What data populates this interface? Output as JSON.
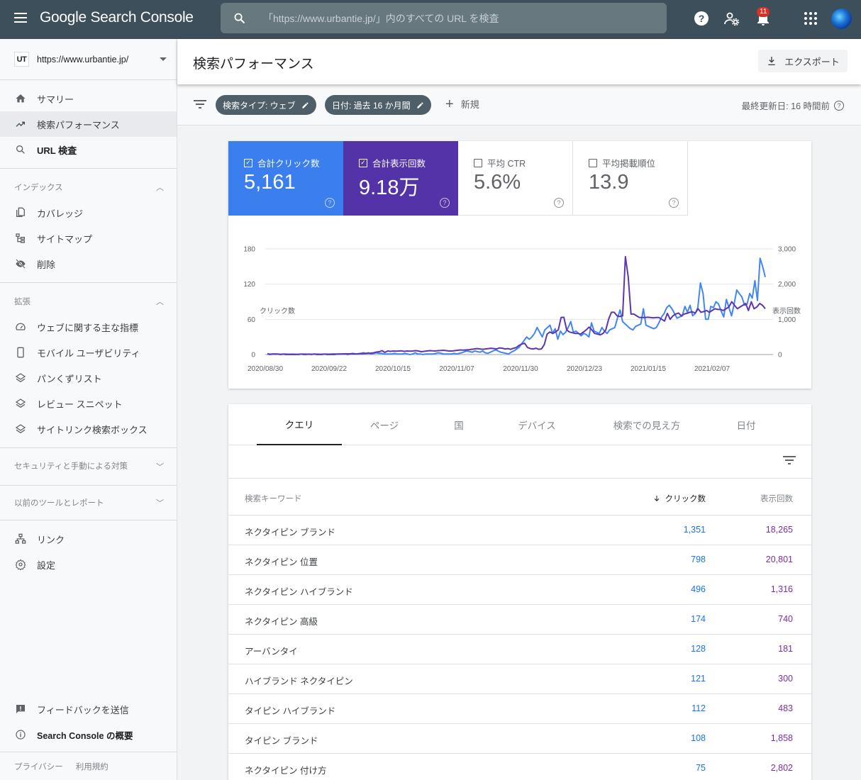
{
  "topbar": {
    "app_name_brand": "Google",
    "app_name_product": "Search Console",
    "search_placeholder": "「https://www.urbantie.jp/」内のすべての URL を検査",
    "notification_count": "11",
    "icons": [
      "menu-icon",
      "search-icon",
      "help-icon",
      "manage-users-icon",
      "notifications-icon",
      "apps-grid-icon",
      "avatar"
    ]
  },
  "sidebar": {
    "property": {
      "badge": "UT",
      "url": "https://www.urbantie.jp/"
    },
    "main_items": [
      {
        "label": "サマリー",
        "icon": "home-icon"
      },
      {
        "label": "検索パフォーマンス",
        "icon": "trending-up-icon",
        "active": true
      },
      {
        "label": "URL 検査",
        "icon": "search-icon"
      }
    ],
    "index_section": {
      "title": "インデックス",
      "items": [
        {
          "label": "カバレッジ",
          "icon": "coverage-icon"
        },
        {
          "label": "サイトマップ",
          "icon": "sitemap-icon"
        },
        {
          "label": "削除",
          "icon": "removal-icon"
        }
      ]
    },
    "enhancements_section": {
      "title": "拡張",
      "items": [
        {
          "label": "ウェブに関する主な指標",
          "icon": "speed-gauge-icon"
        },
        {
          "label": "モバイル ユーザビリティ",
          "icon": "mobile-icon"
        },
        {
          "label": "パンくずリスト",
          "icon": "layers-icon"
        },
        {
          "label": "レビュー スニペット",
          "icon": "layers-icon"
        },
        {
          "label": "サイトリンク検索ボックス",
          "icon": "layers-icon"
        }
      ]
    },
    "security_section": {
      "title": "セキュリティと手動による対策"
    },
    "legacy_section": {
      "title": "以前のツールとレポート"
    },
    "other_items": [
      {
        "label": "リンク",
        "icon": "links-icon"
      },
      {
        "label": "設定",
        "icon": "settings-icon"
      }
    ],
    "bottom_items": [
      {
        "label": "フィードバックを送信",
        "icon": "feedback-icon"
      },
      {
        "label": "Search Console の概要",
        "icon": "info-icon"
      }
    ],
    "footer": {
      "privacy": "プライバシー",
      "terms": "利用規約"
    }
  },
  "header": {
    "title": "検索パフォーマンス",
    "export_label": "エクスポート"
  },
  "filterbar": {
    "chips": [
      {
        "label": "検索タイプ: ウェブ"
      },
      {
        "label": "日付: 過去 16 か月間"
      }
    ],
    "new_label": "新規",
    "last_updated": "最終更新日: 16 時間前"
  },
  "metrics": [
    {
      "label": "合計クリック数",
      "value": "5,161",
      "checked": true,
      "color": "#3b7eee"
    },
    {
      "label": "合計表示回数",
      "value": "9.18万",
      "checked": true,
      "color": "#5433a8"
    },
    {
      "label": "平均 CTR",
      "value": "5.6%",
      "checked": false
    },
    {
      "label": "平均掲載順位",
      "value": "13.9",
      "checked": false
    }
  ],
  "chart_data": {
    "type": "line",
    "left_axis_label": "クリック数",
    "right_axis_label": "表示回数",
    "left_ticks": [
      "180",
      "120",
      "60",
      "0"
    ],
    "right_ticks": [
      "3,000",
      "2,000",
      "1,000",
      "0"
    ],
    "left_ylim": [
      0,
      180
    ],
    "right_ylim": [
      0,
      3000
    ],
    "x_tick_labels": [
      "2020/08/30",
      "2020/09/22",
      "2020/10/15",
      "2020/11/07",
      "2020/11/30",
      "2020/12/23",
      "2021/01/15",
      "2021/02/07"
    ],
    "grid": true,
    "series": [
      {
        "name": "クリック数",
        "axis": "left",
        "color": "#4285f4",
        "values": [
          1,
          0,
          1,
          1,
          1,
          0,
          1,
          0,
          0,
          0,
          0,
          0,
          0,
          1,
          0,
          0,
          1,
          0,
          1,
          0,
          0,
          0,
          1,
          0,
          0,
          0,
          0,
          1,
          1,
          1,
          1,
          0,
          1,
          2,
          1,
          1,
          2,
          3,
          2,
          3,
          1,
          2,
          3,
          2,
          2,
          1,
          1,
          1,
          1,
          2,
          1,
          1,
          1,
          2,
          1,
          0,
          1,
          3,
          1,
          1,
          0,
          1,
          1,
          1,
          1,
          2,
          3,
          2,
          1,
          1,
          1,
          1,
          2,
          1,
          2,
          3,
          5,
          6,
          5,
          4,
          6,
          5,
          4,
          6,
          3,
          2,
          4,
          6,
          8,
          6,
          4,
          3,
          2,
          1,
          4,
          6,
          9,
          12,
          18,
          24,
          30,
          26,
          30,
          36,
          46,
          38,
          30,
          42,
          46,
          50,
          36,
          44,
          26,
          40,
          34,
          38,
          46,
          56,
          38,
          40,
          36,
          32,
          36,
          34,
          30,
          54,
          40,
          38,
          36,
          46,
          40,
          36,
          42,
          44,
          46,
          62,
          76,
          56,
          52,
          48,
          44,
          42,
          48,
          50,
          52,
          78,
          50,
          48,
          46,
          44,
          46,
          54,
          64,
          70,
          80,
          84,
          78,
          70,
          62,
          64,
          66,
          82,
          72,
          84,
          66,
          70,
          80,
          122,
          104,
          60,
          60,
          82,
          80,
          90,
          86,
          74,
          64,
          94,
          80,
          66,
          86,
          110,
          104,
          98,
          84,
          86,
          104,
          96,
          126,
          92,
          164,
          150,
          132
        ]
      },
      {
        "name": "表示回数",
        "axis": "right",
        "color": "#5e35b1",
        "values": [
          20,
          10,
          15,
          12,
          10,
          8,
          12,
          10,
          8,
          10,
          8,
          9,
          10,
          12,
          10,
          8,
          10,
          12,
          10,
          8,
          10,
          12,
          10,
          12,
          14,
          12,
          16,
          18,
          20,
          20,
          22,
          18,
          20,
          24,
          26,
          30,
          34,
          40,
          50,
          70,
          80,
          110,
          60,
          100,
          90,
          100,
          95,
          100,
          105,
          90,
          100,
          95,
          100,
          110,
          100,
          80,
          90,
          100,
          110,
          105,
          100,
          110,
          115,
          120,
          110,
          100,
          100,
          110,
          120,
          130,
          125,
          130,
          135,
          150,
          160,
          170,
          160,
          150,
          160,
          170,
          180,
          170,
          160,
          190,
          180,
          160,
          170,
          150,
          180,
          200,
          260,
          300,
          320,
          200,
          170,
          160,
          180,
          150,
          160,
          280,
          580,
          640,
          600,
          640,
          700,
          1050,
          1060,
          700,
          640,
          620,
          600,
          600,
          580,
          640,
          700,
          780,
          700,
          600,
          580,
          560,
          600,
          700,
          1000,
          1200,
          1200,
          1100,
          1080,
          1100,
          2780,
          2200,
          1150,
          1150,
          1100,
          1050,
          1050,
          1050,
          1060,
          1050,
          1040,
          1050,
          1050,
          1000,
          950,
          1170,
          1000,
          1100,
          1150,
          1180,
          1100,
          1150,
          1170,
          1200,
          1210,
          1180,
          1300,
          1200,
          1220,
          1250,
          1200,
          1250,
          1300,
          1280,
          1280,
          1250,
          1300,
          1350,
          1500,
          1400,
          1300,
          1350,
          1400,
          1450,
          1250,
          1500,
          1300,
          1350,
          1450,
          1400,
          1300
        ]
      }
    ]
  },
  "table": {
    "tabs": [
      "クエリ",
      "ページ",
      "国",
      "デバイス",
      "検索での見え方",
      "日付"
    ],
    "active_tab": "クエリ",
    "columns": [
      "検索キーワード",
      "クリック数",
      "表示回数"
    ],
    "sort_column": "クリック数",
    "sort_direction": "descending",
    "rows": [
      {
        "query": "ネクタイピン ブランド",
        "clicks": "1,351",
        "impressions": "18,265"
      },
      {
        "query": "ネクタイピン 位置",
        "clicks": "798",
        "impressions": "20,801"
      },
      {
        "query": "ネクタイピン ハイブランド",
        "clicks": "496",
        "impressions": "1,316"
      },
      {
        "query": "ネクタイピン 高級",
        "clicks": "174",
        "impressions": "740"
      },
      {
        "query": "アーバンタイ",
        "clicks": "128",
        "impressions": "181"
      },
      {
        "query": "ハイブランド ネクタイピン",
        "clicks": "121",
        "impressions": "300"
      },
      {
        "query": "タイピン ハイブランド",
        "clicks": "112",
        "impressions": "483"
      },
      {
        "query": "タイピン ブランド",
        "clicks": "108",
        "impressions": "1,858"
      },
      {
        "query": "ネクタイピン 付け方",
        "clicks": "75",
        "impressions": "2,802"
      }
    ]
  }
}
